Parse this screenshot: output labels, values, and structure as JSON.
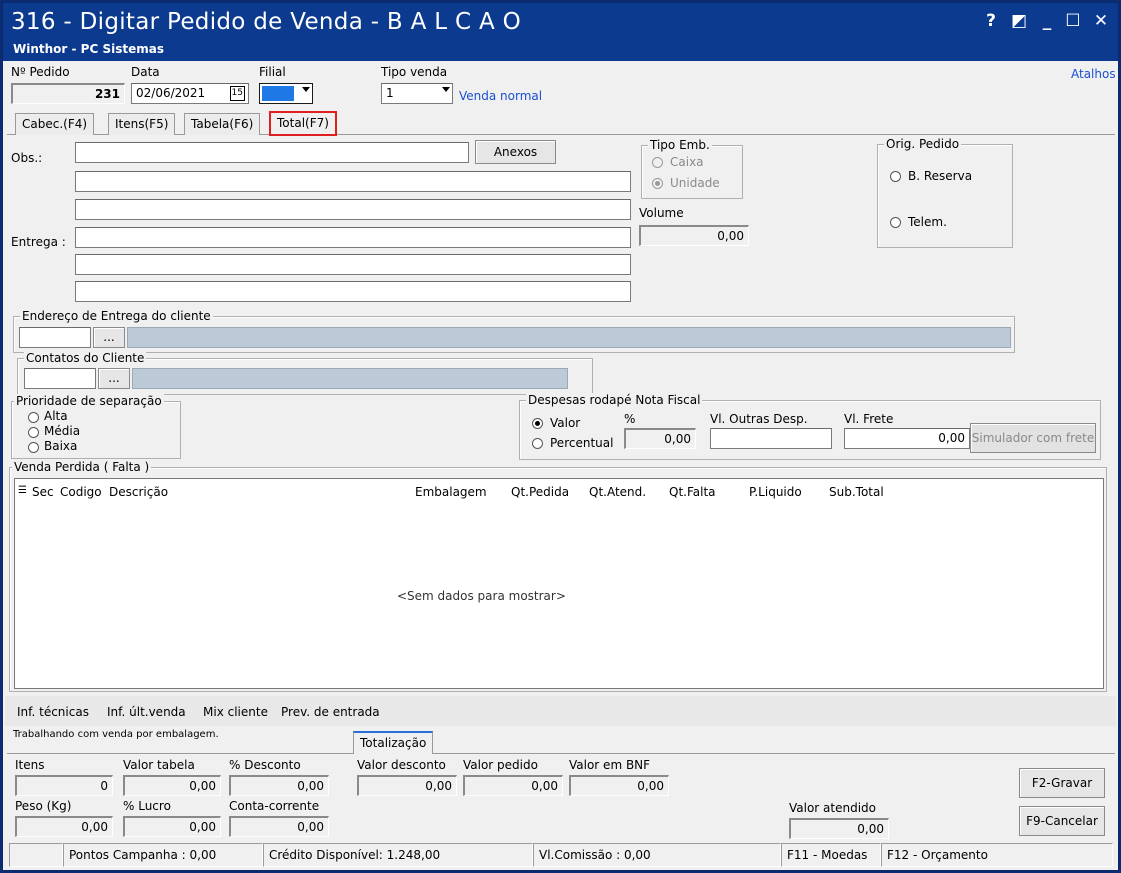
{
  "window": {
    "title": "316 - Digitar Pedido de Venda - B A L C A O",
    "subtitle": "Winthor - PC Sistemas",
    "controls": [
      "?",
      "◩",
      "_",
      "☐",
      "✕"
    ]
  },
  "header": {
    "pedido_label": "Nº Pedido",
    "pedido_value": "231",
    "data_label": "Data",
    "data_value": "02/06/2021",
    "filial_label": "Filial",
    "tipo_venda_label": "Tipo venda",
    "tipo_venda_value": "1",
    "tipo_venda_desc": "Venda normal",
    "atalhos": "Atalhos",
    "calendar_icon_text": "15"
  },
  "tabs": [
    {
      "label": "Cabec.(F4)"
    },
    {
      "label": "Itens(F5)"
    },
    {
      "label": "Tabela(F6)"
    },
    {
      "label": "Total(F7)",
      "active": true
    }
  ],
  "main": {
    "obs_label": "Obs.:",
    "anexos_button": "Anexos",
    "entrega_label": "Entrega :",
    "tipo_emb": {
      "title": "Tipo Emb.",
      "caixa": "Caixa",
      "unidade": "Unidade"
    },
    "volume_label": "Volume",
    "volume_value": "0,00",
    "orig_pedido": {
      "title": "Orig. Pedido",
      "reserva": "B. Reserva",
      "telem": "Telem."
    },
    "endereco_title": "Endereço de Entrega do cliente",
    "contatos_title": "Contatos do Cliente",
    "ellipsis": "...",
    "prioridade": {
      "title": "Prioridade de separação",
      "alta": "Alta",
      "media": "Média",
      "baixa": "Baixa"
    },
    "despesas": {
      "title": "Despesas rodapé Nota Fiscal",
      "valor": "Valor",
      "percentual": "Percentual",
      "pct_label": "%",
      "pct_value": "0,00",
      "outras_label": "Vl. Outras Desp.",
      "frete_label": "Vl. Frete",
      "frete_value": "0,00",
      "simulador_button": "Simulador com frete"
    }
  },
  "venda_perdida": {
    "title": "Venda Perdida ( Falta )",
    "columns": [
      "Sec",
      "Codigo",
      "Descrição",
      "Embalagem",
      "Qt.Pedida",
      "Qt.Atend.",
      "Qt.Falta",
      "P.Liquido",
      "Sub.Total"
    ],
    "empty_text": "<Sem dados para mostrar>"
  },
  "links": [
    "Inf. técnicas",
    "Inf. últ.venda",
    "Mix cliente",
    "Prev. de entrada"
  ],
  "footer": {
    "info_text": "Trabalhando com venda por embalagem.",
    "totalizacao_tab": "Totalização",
    "itens_label": "Itens",
    "itens_value": "0",
    "valor_tabela_label": "Valor tabela",
    "valor_tabela_value": "0,00",
    "desconto_pct_label": "% Desconto",
    "desconto_pct_value": "0,00",
    "valor_desconto_label": "Valor desconto",
    "valor_desconto_value": "0,00",
    "valor_pedido_label": "Valor pedido",
    "valor_pedido_value": "0,00",
    "valor_bnf_label": "Valor em BNF",
    "valor_bnf_value": "0,00",
    "peso_label": "Peso (Kg)",
    "peso_value": "0,00",
    "lucro_label": "% Lucro",
    "lucro_value": "0,00",
    "conta_label": "Conta-corrente",
    "conta_value": "0,00",
    "valor_atendido_label": "Valor atendido",
    "valor_atendido_value": "0,00",
    "gravar_button": "F2-Gravar",
    "cancelar_button": "F9-Cancelar"
  },
  "statusbar": {
    "pontos": "Pontos Campanha : 0,00",
    "credito": "Crédito Disponível: 1.248,00",
    "comissao": "Vl.Comissão : 0,00",
    "moedas": "F11 - Moedas",
    "orcamento": "F12 - Orçamento"
  },
  "colors": {
    "titlebar": "#0b3a8f",
    "link": "#1a4fd1",
    "highlight": "#e02020",
    "filial": "#1e78e6"
  }
}
